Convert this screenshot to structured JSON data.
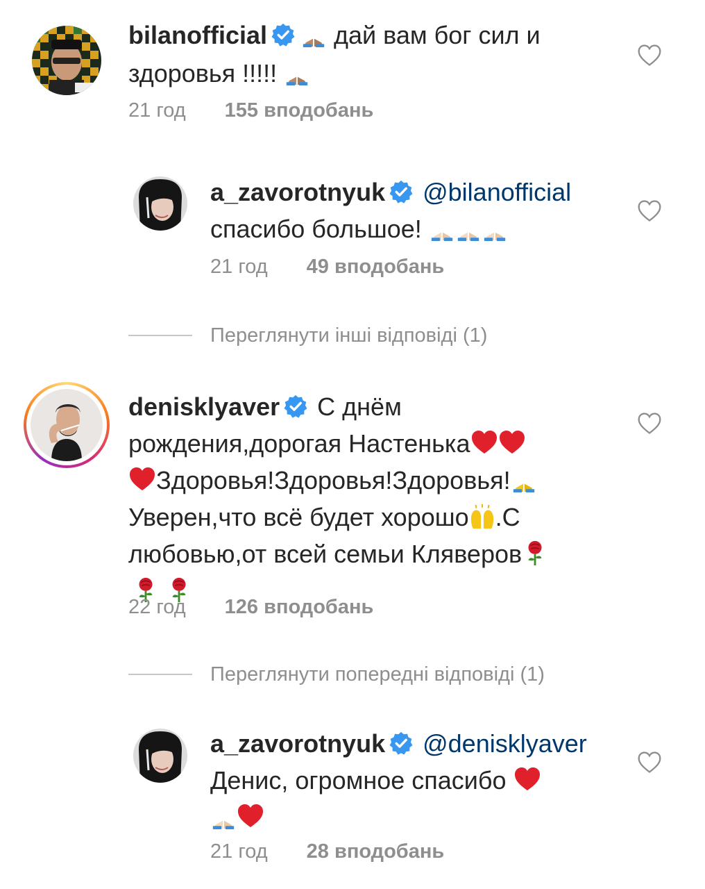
{
  "comments": [
    {
      "username": "bilanofficial",
      "text_a": " дай вам бог сил и",
      "text_b": "здоровья !!!!! ",
      "time": "21 год",
      "likes": "155 вподобань"
    },
    {
      "username": "a_zavorotnyuk",
      "mention": "@bilanofficial",
      "text_a": "спасибо большое! ",
      "time": "21 год",
      "likes": "49 вподобань"
    },
    {
      "username": "denisklyaver",
      "line1": " С днём",
      "line2": "рождения,дорогая Настенька",
      "line3": "Здоровья!Здоровья!Здоровья!",
      "line4a": "Уверен,что всё будет хорошо",
      "line4b": ".С",
      "line5": "любовью,от всей семьи Кляверов",
      "time": "22 год",
      "likes": "126 вподобань"
    },
    {
      "username": "a_zavorotnyuk",
      "mention": "@denisklyaver",
      "text_a": "Денис, огромное спасибо ",
      "time": "21 год",
      "likes": "28 вподобань"
    }
  ],
  "view_other_replies": "Переглянути інші відповіді (1)",
  "view_previous_replies": "Переглянути попередні відповіді (1)",
  "icons": [
    "verified-badge-icon",
    "heart-icon",
    "folded-hands-emoji",
    "red-heart-emoji",
    "raising-hands-emoji",
    "rose-emoji"
  ],
  "colors": {
    "verified": "#3897f0",
    "mention": "#00376b",
    "meta": "#8e8e8e",
    "heart_emoji": "#e0202a"
  }
}
